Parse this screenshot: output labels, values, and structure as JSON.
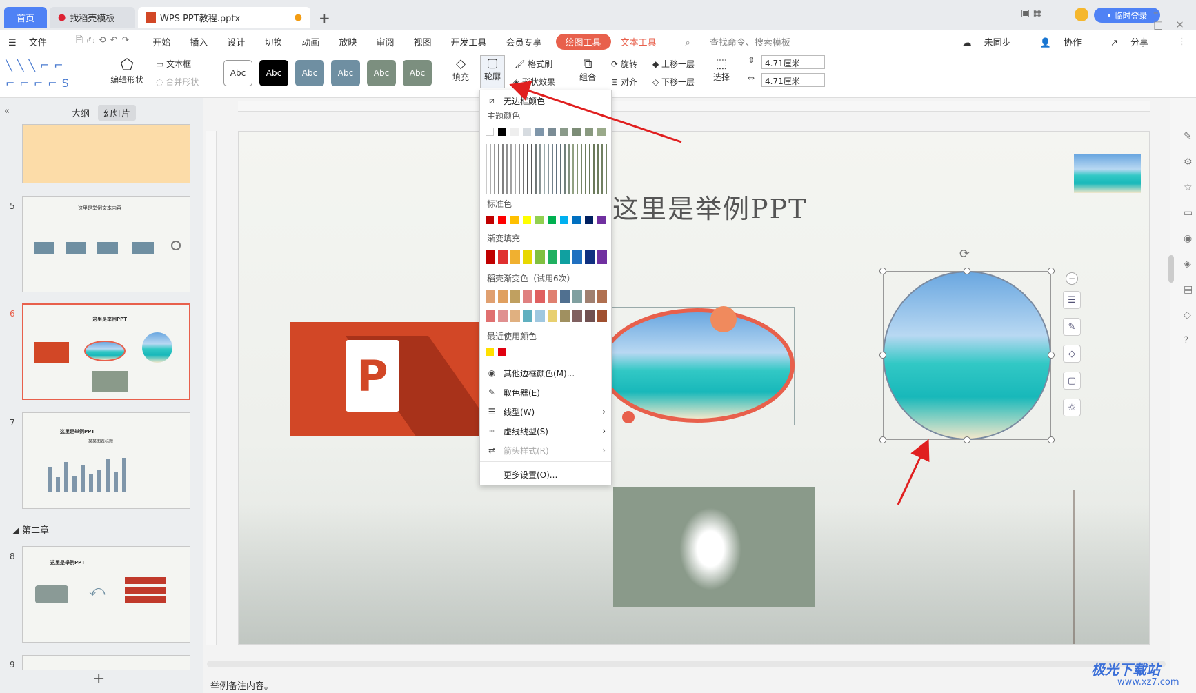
{
  "tabs": {
    "home": "首页",
    "template": "找稻壳模板",
    "doc": "WPS PPT教程.pptx",
    "new": "+"
  },
  "topright": {
    "login": "• 临时登录"
  },
  "menu": {
    "file": "文件",
    "items": [
      "开始",
      "插入",
      "设计",
      "切换",
      "动画",
      "放映",
      "审阅",
      "视图",
      "开发工具",
      "会员专享"
    ],
    "drawing_tool": "绘图工具",
    "text_tool": "文本工具",
    "search": "查找命令、搜索模板",
    "sync": "未同步",
    "collab": "协作",
    "share": "分享"
  },
  "ribbon": {
    "edit_shape": "编辑形状",
    "textbox": "文本框",
    "merge_shape": "合并形状",
    "style_label": "Abc",
    "fill": "填充",
    "outline": "轮廓",
    "format_brush": "格式刷",
    "shape_effect": "形状效果",
    "group": "组合",
    "rotate": "旋转",
    "align": "对齐",
    "up_layer": "上移一层",
    "down_layer": "下移一层",
    "select": "选择",
    "height": "4.71厘米",
    "width": "4.71厘米",
    "style_colors": [
      "#ffffff",
      "#000000",
      "#6f8fa2",
      "#6f8fa2",
      "#7c8f7f",
      "#7c8f7f"
    ]
  },
  "leftpanel": {
    "tab_outline": "大纲",
    "tab_slides": "幻灯片",
    "chapter": "第二章",
    "slide_nums": [
      "5",
      "6",
      "7",
      "8",
      "9"
    ],
    "thumb_title": "这里是举例PPT",
    "thumb5_text": "这里是举例文本内容",
    "thumb7_sub": "某某图表标题",
    "add": "+"
  },
  "slide": {
    "title": "这里是举例PPT"
  },
  "dropdown": {
    "no_border": "无边框颜色",
    "theme": "主题颜色",
    "standard": "标准色",
    "gradient": "渐变填充",
    "docer_gradient": "稻壳渐变色（试用6次）",
    "recent": "最近使用颜色",
    "more_colors": "其他边框颜色(M)...",
    "picker": "取色器(E)",
    "line_type": "线型(W)",
    "dash_type": "虚线线型(S)",
    "arrow_style": "箭头样式(R)",
    "more_settings": "更多设置(O)...",
    "theme_top": [
      "#ffffff",
      "#000000",
      "#eeeeee",
      "#d6dbe0",
      "#7f96aa",
      "#7b8c95",
      "#8a9a8a",
      "#7c8c76",
      "#8a9a80",
      "#9aaa8a"
    ],
    "standard_colors": [
      "#c00000",
      "#ff0000",
      "#ffc000",
      "#ffff00",
      "#92d050",
      "#00b050",
      "#00b0f0",
      "#0070c0",
      "#002060",
      "#7030a0"
    ],
    "gradient_colors": [
      "#c00000",
      "#e03030",
      "#f0b030",
      "#e8d800",
      "#80c040",
      "#20b060",
      "#10a0a0",
      "#2070c0",
      "#103080",
      "#7030a0"
    ],
    "docer_row1": [
      "#e0a070",
      "#e0a060",
      "#c0a060",
      "#e08080",
      "#e06060",
      "#e08070",
      "#507090",
      "#80a0a0",
      "#a08070",
      "#b07050"
    ],
    "docer_row2": [
      "#e07070",
      "#e09090",
      "#e0b080",
      "#60b0c0",
      "#a0c8e0",
      "#e8d070",
      "#a09060",
      "#806060",
      "#705050",
      "#a05030"
    ],
    "recent_colors": [
      "#ffe000",
      "#e00010"
    ]
  },
  "statusbar": {
    "notes": "举例备注内容。"
  },
  "watermark": "极光下载站",
  "watermark_url": "www.xz7.com"
}
